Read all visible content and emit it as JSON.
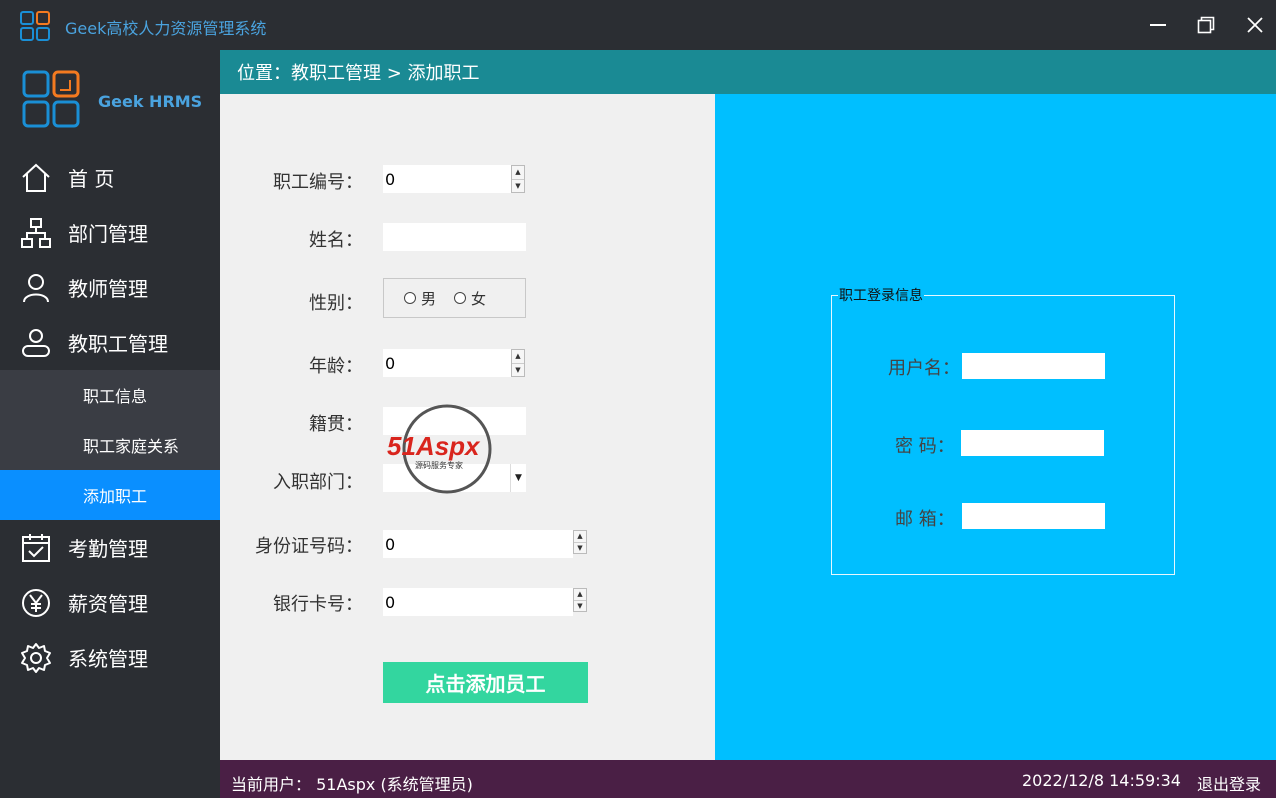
{
  "window": {
    "title": "Geek高校人力资源管理系统"
  },
  "brand": {
    "name": "Geek HRMS"
  },
  "sidebar": {
    "items": [
      {
        "label": "首 页",
        "icon": "home-icon"
      },
      {
        "label": "部门管理",
        "icon": "org-chart-icon"
      },
      {
        "label": "教师管理",
        "icon": "user-icon"
      },
      {
        "label": "教职工管理",
        "icon": "user-outline-icon"
      },
      {
        "label": "考勤管理",
        "icon": "calendar-check-icon"
      },
      {
        "label": "薪资管理",
        "icon": "yen-icon"
      },
      {
        "label": "系统管理",
        "icon": "gear-icon"
      }
    ],
    "subitems": [
      {
        "label": "职工信息"
      },
      {
        "label": "职工家庭关系"
      },
      {
        "label": "添加职工",
        "active": true
      }
    ]
  },
  "breadcrumb": {
    "text": "位置：教职工管理 > 添加职工"
  },
  "form": {
    "staff_id_label": "职工编号：",
    "staff_id_value": "0",
    "name_label": "姓名：",
    "name_value": "",
    "gender_label": "性别：",
    "gender_options": [
      "男",
      "女"
    ],
    "age_label": "年龄：",
    "age_value": "0",
    "hometown_label": "籍贯：",
    "hometown_value": "",
    "department_label": "入职部门：",
    "department_value": "",
    "id_number_label": "身份证号码：",
    "id_number_value": "0",
    "bank_card_label": "银行卡号：",
    "bank_card_value": "0",
    "submit_label": "点击添加员工"
  },
  "login_info": {
    "legend": "职工登录信息",
    "username_label": "用户名：",
    "password_label": "密  码：",
    "email_label": "邮  箱："
  },
  "watermark": {
    "brand": "51Aspx",
    "tagline": "源码服务专家"
  },
  "status": {
    "current_user": "当前用户：  51Aspx (系统管理员)",
    "datetime": "2022/12/8 14:59:34",
    "logout_label": "退出登录"
  },
  "colors": {
    "accent_blue": "#0a8fff",
    "teal_header": "#1a8a94",
    "right_panel": "#00bfff",
    "submit_green": "#33d69f",
    "status_bar": "#4a1f45",
    "logo_orange": "#f47a20",
    "logo_blue": "#1a8fd6"
  }
}
